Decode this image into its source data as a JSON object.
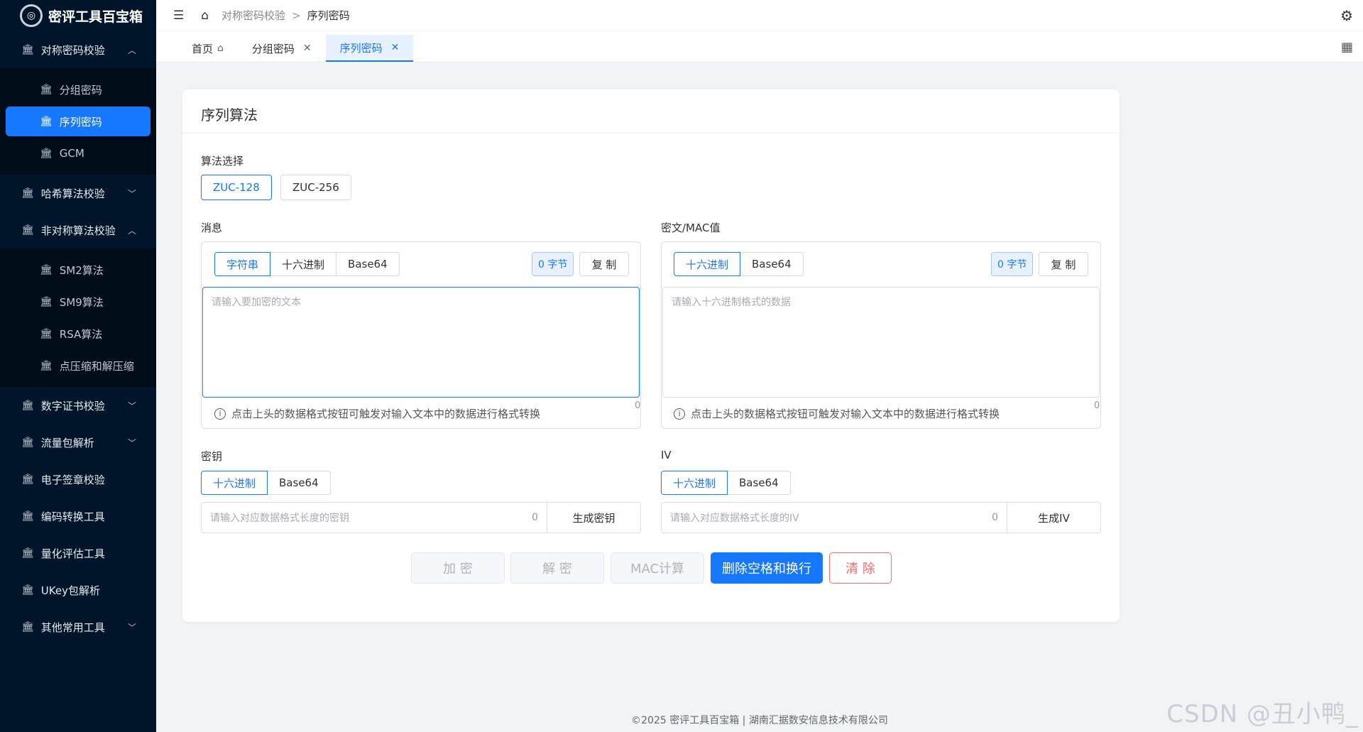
{
  "app": {
    "title": "密评工具百宝箱",
    "logo_icon": "shield-logo-icon"
  },
  "sidebar": {
    "groups": [
      {
        "label": "对称密码校验",
        "expanded": true
      },
      {
        "label": "哈希算法校验",
        "expanded": false
      },
      {
        "label": "非对称算法校验",
        "expanded": true
      },
      {
        "label": "数字证书校验",
        "expanded": false
      },
      {
        "label": "流量包解析",
        "expanded": false
      },
      {
        "label": "电子签章校验"
      },
      {
        "label": "编码转换工具"
      },
      {
        "label": "量化评估工具"
      },
      {
        "label": "UKey包解析"
      },
      {
        "label": "其他常用工具",
        "expanded": false
      }
    ],
    "symmetric_items": [
      "分组密码",
      "序列密码",
      "GCM"
    ],
    "asymmetric_items": [
      "SM2算法",
      "SM9算法",
      "RSA算法",
      "点压缩和解压缩"
    ],
    "active_item": "序列密码"
  },
  "breadcrumb": {
    "parent": "对称密码校验",
    "separator": ">",
    "current": "序列密码"
  },
  "tabs": [
    {
      "label": "首页",
      "closable": false
    },
    {
      "label": "分组密码",
      "closable": true
    },
    {
      "label": "序列密码",
      "closable": true,
      "active": true
    }
  ],
  "card": {
    "title": "序列算法"
  },
  "algo": {
    "label": "算法选择",
    "options": [
      "ZUC-128",
      "ZUC-256"
    ],
    "selected": "ZUC-128"
  },
  "message": {
    "label": "消息",
    "formats": [
      "字符串",
      "十六进制",
      "Base64"
    ],
    "selected": "字符串",
    "bytes": "0 字节",
    "copy": "复 制",
    "placeholder": "请输入要加密的文本",
    "count": "0",
    "hint": "点击上头的数据格式按钮可触发对输入文本中的数据进行格式转换"
  },
  "cipher": {
    "label": "密文/MAC值",
    "formats": [
      "十六进制",
      "Base64"
    ],
    "selected": "十六进制",
    "bytes": "0 字节",
    "copy": "复 制",
    "placeholder": "请输入十六进制格式的数据",
    "count": "0",
    "hint": "点击上头的数据格式按钮可触发对输入文本中的数据进行格式转换"
  },
  "key": {
    "label": "密钥",
    "formats": [
      "十六进制",
      "Base64"
    ],
    "selected": "十六进制",
    "placeholder": "请输入对应数据格式长度的密钥",
    "count": "0",
    "generate": "生成密钥"
  },
  "iv": {
    "label": "IV",
    "formats": [
      "十六进制",
      "Base64"
    ],
    "selected": "十六进制",
    "placeholder": "请输入对应数据格式长度的IV",
    "count": "0",
    "generate": "生成IV"
  },
  "actions": {
    "encrypt": "加 密",
    "decrypt": "解 密",
    "mac": "MAC计算",
    "strip": "删除空格和换行",
    "clear": "清 除"
  },
  "footer": "©2025 密评工具百宝箱 | 湖南汇据数安信息技术有限公司",
  "corner_watermark": "CSDN @丑小鸭_",
  "colors": {
    "primary": "#1677ff",
    "sidebar": "#001529",
    "danger": "#f56c6c"
  }
}
